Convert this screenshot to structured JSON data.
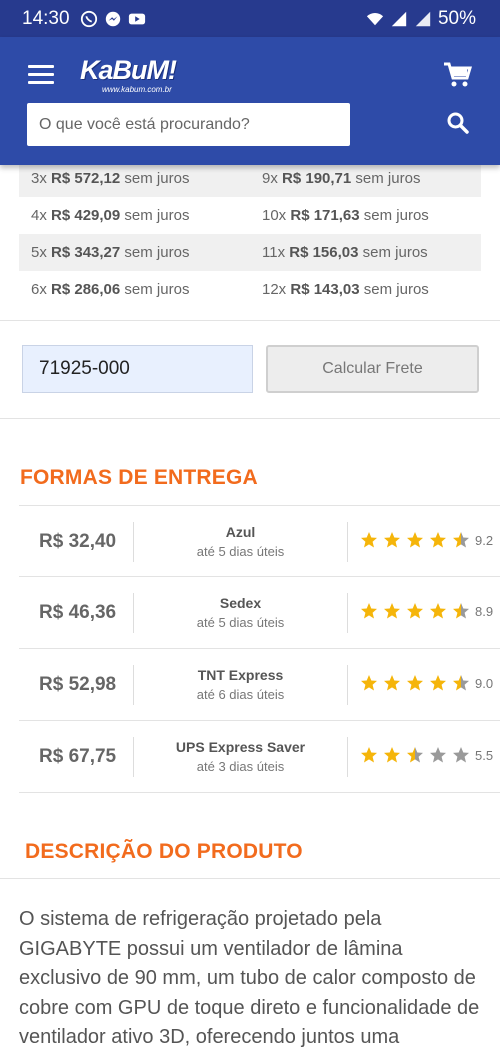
{
  "status_bar": {
    "time": "14:30",
    "battery": "50%"
  },
  "header": {
    "logo_text": "KaBuM!",
    "logo_sub": "www.kabum.com.br",
    "search_placeholder": "O que você está procurando?"
  },
  "installments": [
    [
      {
        "n": "3x",
        "v": "R$ 572,12",
        "s": "sem juros"
      },
      {
        "n": "9x",
        "v": "R$ 190,71",
        "s": "sem juros"
      }
    ],
    [
      {
        "n": "4x",
        "v": "R$ 429,09",
        "s": "sem juros"
      },
      {
        "n": "10x",
        "v": "R$ 171,63",
        "s": "sem juros"
      }
    ],
    [
      {
        "n": "5x",
        "v": "R$ 343,27",
        "s": "sem juros"
      },
      {
        "n": "11x",
        "v": "R$ 156,03",
        "s": "sem juros"
      }
    ],
    [
      {
        "n": "6x",
        "v": "R$ 286,06",
        "s": "sem juros"
      },
      {
        "n": "12x",
        "v": "R$ 143,03",
        "s": "sem juros"
      }
    ]
  ],
  "freight": {
    "cep_value": "71925-000",
    "button_label": "Calcular Frete"
  },
  "delivery": {
    "title": "FORMAS DE ENTREGA",
    "options": [
      {
        "price": "R$ 32,40",
        "name": "Azul",
        "time": "até 5 dias úteis",
        "stars": 4.5,
        "score": "9.2"
      },
      {
        "price": "R$ 46,36",
        "name": "Sedex",
        "time": "até 5 dias úteis",
        "stars": 4.5,
        "score": "8.9"
      },
      {
        "price": "R$ 52,98",
        "name": "TNT Express",
        "time": "até 6 dias úteis",
        "stars": 4.5,
        "score": "9.0"
      },
      {
        "price": "R$ 67,75",
        "name": "UPS Express Saver",
        "time": "até 3 dias úteis",
        "stars": 2.5,
        "score": "5.5"
      }
    ]
  },
  "description": {
    "title": "DESCRIÇÃO DO PRODUTO",
    "text": "O sistema de refrigeração projetado pela GIGABYTE possui um ventilador de lâmina exclusivo de 90 mm, um tubo de calor composto de cobre com GPU de toque direto e funcionalidade de ventilador ativo 3D, oferecendo juntos uma capacidade efetiva de"
  },
  "colors": {
    "header": "#2e4ba8",
    "accent": "#f26b1d",
    "star": "#f5b50a",
    "star_empty": "#9a9a9a"
  }
}
